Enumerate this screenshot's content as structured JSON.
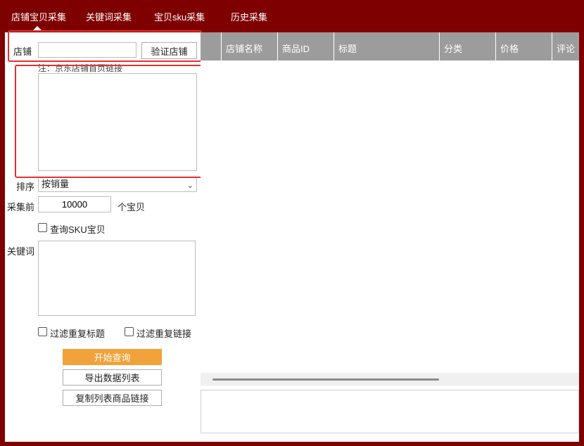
{
  "tabs": [
    {
      "label": "店铺宝贝采集",
      "active": true
    },
    {
      "label": "关键词采集"
    },
    {
      "label": "宝贝sku采集"
    },
    {
      "label": "历史采集"
    }
  ],
  "shop": {
    "label": "店铺",
    "input_value": "",
    "verify_button": "验证店铺",
    "note": "注：京东店铺首页链接",
    "links_value": ""
  },
  "sort": {
    "label": "排序",
    "selected": "按销量"
  },
  "collect": {
    "prefix": "采集前",
    "value": "10000",
    "suffix": "个宝贝"
  },
  "sku_checkbox": {
    "label": "查询SKU宝贝",
    "checked": false
  },
  "keywords": {
    "label": "关键词",
    "value": ""
  },
  "filters": [
    {
      "label": "过滤重复标题",
      "checked": false
    },
    {
      "label": "过滤重复链接",
      "checked": false
    }
  ],
  "buttons": {
    "start": "开始查询",
    "export": "导出数据列表",
    "copy_links": "复制列表商品链接"
  },
  "table": {
    "columns": [
      "店铺名称",
      "商品ID",
      "标题",
      "分类",
      "价格",
      "评论"
    ],
    "rows": []
  },
  "colors": {
    "frame": "#7f0000",
    "accent": "#f1a23a",
    "highlight": "#e53030",
    "header": "#9c9c9c"
  }
}
